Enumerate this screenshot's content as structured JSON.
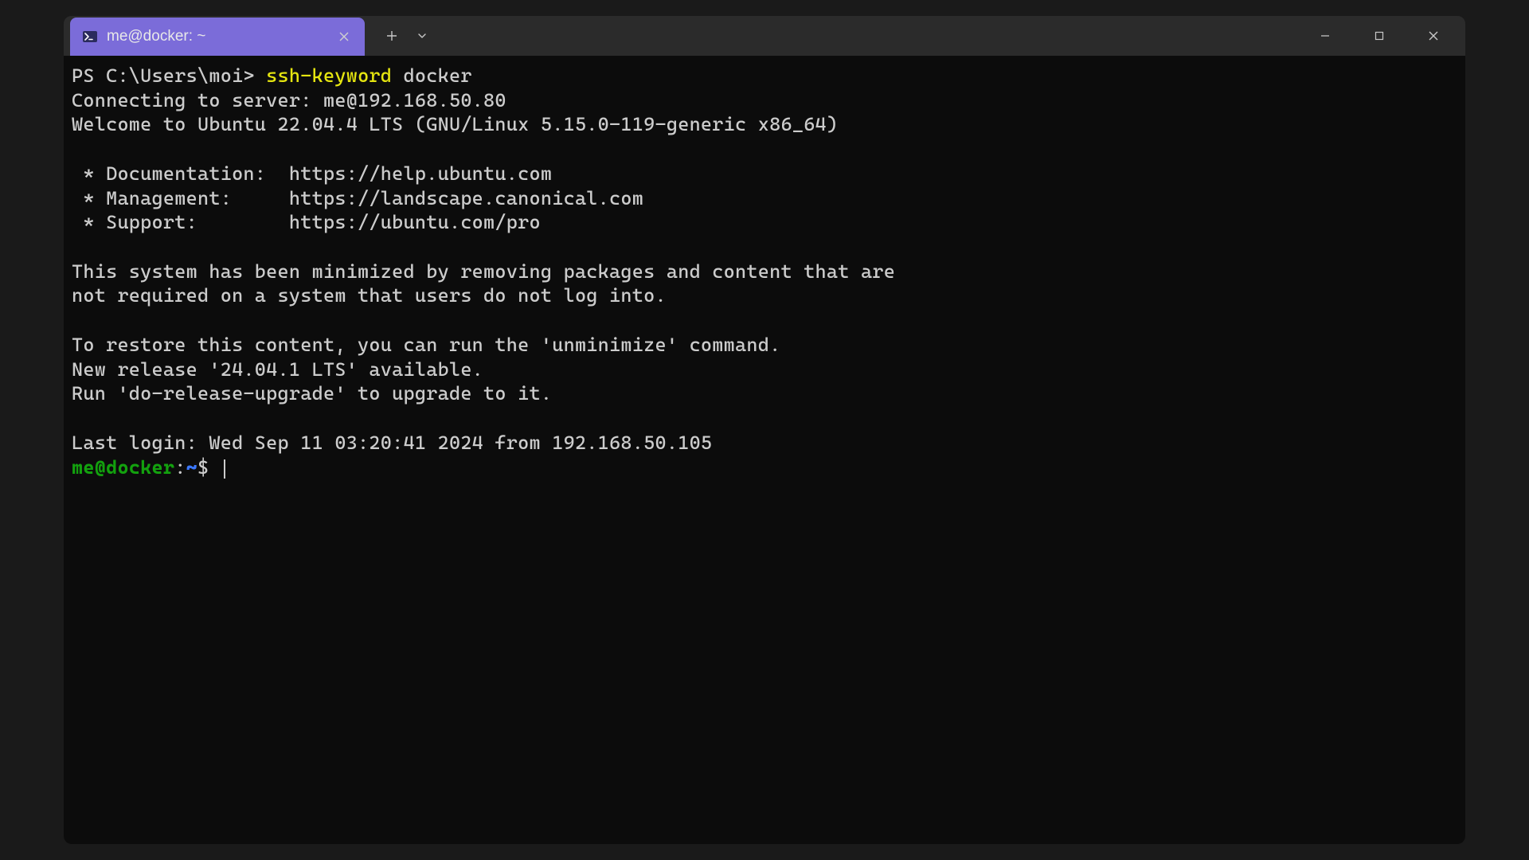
{
  "tab": {
    "title": "me@docker: ~"
  },
  "terminal": {
    "ps_prompt": "PS C:\\Users\\moi> ",
    "command": "ssh-keyword",
    "command_arg": " docker",
    "lines": {
      "connecting": "Connecting to server: me@192.168.50.80",
      "welcome": "Welcome to Ubuntu 22.04.4 LTS (GNU/Linux 5.15.0-119-generic x86_64)",
      "doc": " * Documentation:  https://help.ubuntu.com",
      "mgmt": " * Management:     https://landscape.canonical.com",
      "support": " * Support:        https://ubuntu.com/pro",
      "minimized1": "This system has been minimized by removing packages and content that are",
      "minimized2": "not required on a system that users do not log into.",
      "restore": "To restore this content, you can run the 'unminimize' command.",
      "release1": "New release '24.04.1 LTS' available.",
      "release2": "Run 'do-release-upgrade' to upgrade to it.",
      "lastlogin": "Last login: Wed Sep 11 03:20:41 2024 from 192.168.50.105"
    },
    "bash_prompt": {
      "userhost": "me@docker",
      "colon": ":",
      "path": "~",
      "dollar": "$ "
    }
  }
}
